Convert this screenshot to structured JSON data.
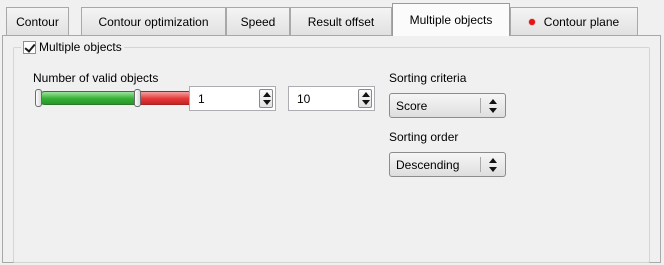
{
  "tabs": [
    {
      "label": "Contour"
    },
    {
      "label": "Contour optimization"
    },
    {
      "label": "Speed"
    },
    {
      "label": "Result offset"
    },
    {
      "label": "Multiple objects",
      "active": true
    },
    {
      "label": "Contour plane",
      "indicator_color": "#e11111"
    }
  ],
  "group": {
    "title": "Multiple objects",
    "checked": true
  },
  "valid_objects": {
    "label": "Number of valid objects",
    "range_fill_fraction": 0.5,
    "colors": {
      "range": "#35b035",
      "outside": "#e43a3a"
    },
    "min_value": "1",
    "max_value": "10"
  },
  "sorting_criteria": {
    "label": "Sorting criteria",
    "value": "Score"
  },
  "sorting_order": {
    "label": "Sorting order",
    "value": "Descending"
  }
}
